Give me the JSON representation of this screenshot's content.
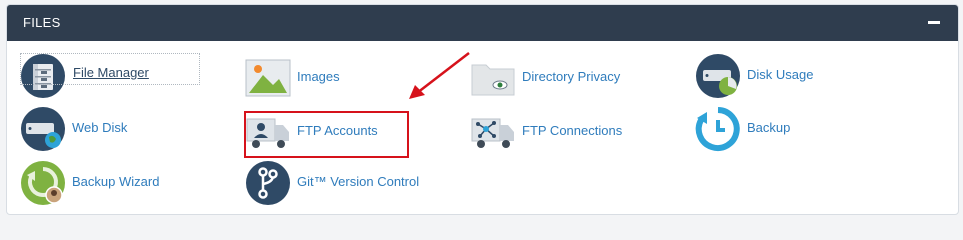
{
  "panel": {
    "title": "FILES",
    "collapse_label": "minus"
  },
  "items": [
    {
      "id": "file-manager",
      "label": "File Manager"
    },
    {
      "id": "images",
      "label": "Images"
    },
    {
      "id": "directory-privacy",
      "label": "Directory Privacy"
    },
    {
      "id": "disk-usage",
      "label": "Disk Usage"
    },
    {
      "id": "web-disk",
      "label": "Web Disk"
    },
    {
      "id": "ftp-accounts",
      "label": "FTP Accounts"
    },
    {
      "id": "ftp-connections",
      "label": "FTP Connections"
    },
    {
      "id": "backup",
      "label": "Backup"
    },
    {
      "id": "backup-wizard",
      "label": "Backup Wizard"
    },
    {
      "id": "git-version-control",
      "label": "Git™ Version Control"
    }
  ],
  "colors": {
    "header_bg": "#2f3d4e",
    "link": "#2f7cbc",
    "highlight": "#d6121b",
    "icon_circle_dark": "#2f4a66",
    "backup_blue": "#2ea3d8",
    "backup_wizard_green": "#7fb241"
  },
  "icons": {
    "file-manager": "filing-cabinet-icon",
    "images": "landscape-image-icon",
    "directory-privacy": "folder-eye-icon",
    "disk-usage": "drive-pie-icon",
    "web-disk": "drive-globe-icon",
    "ftp-accounts": "truck-user-icon",
    "ftp-connections": "truck-network-icon",
    "backup": "circular-arrow-clock-icon",
    "backup-wizard": "wizard-backup-icon",
    "git-version-control": "git-branch-icon"
  }
}
